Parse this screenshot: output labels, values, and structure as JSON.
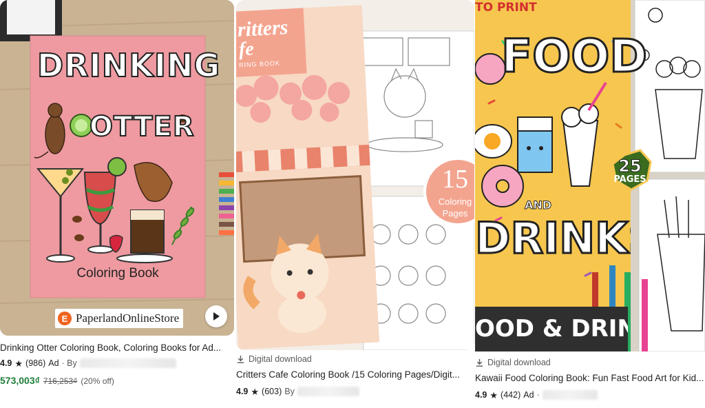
{
  "cards": [
    {
      "cover_title_line1": "DRINKING",
      "cover_title_line2": "OTTER",
      "cover_subtitle": "Coloring Book",
      "shop_logo_letter": "E",
      "shop_name": "PaperlandOnlineStore",
      "title": "Drinking Otter Coloring Book, Coloring Books for Ad...",
      "rating": "4.9",
      "reviews": "(986)",
      "ad_label": "Ad",
      "by_label": "· By",
      "price": "573,003₫",
      "original_price": "716,253₫",
      "discount": "(20% off)",
      "cover_color": "#ee9aa0",
      "price_color": "#1e7d3a"
    },
    {
      "cover_title_line1": "ritters",
      "cover_title_line2": "fe",
      "cover_subtitle": "RING BOOK",
      "badge_number": "15",
      "badge_line1": "Coloring",
      "badge_line2": "Pages",
      "download_label": "Digital download",
      "title": "Critters Cafe Coloring Book /15 Coloring Pages/Digit...",
      "rating": "4.9",
      "reviews": "(603)",
      "by_label": "By",
      "accent_color": "#f3a48f"
    },
    {
      "banner_text": "TO PRINT",
      "cover_word1": "FOOD",
      "cover_and": "AND",
      "cover_word2": "DRINKS",
      "badge_number": "25",
      "badge_label": "PAGES",
      "bottom_banner": "OOD & DRINKS",
      "download_label": "Digital download",
      "title": "Kawaii Food Coloring Book: Fun Fast Food Art for Kid...",
      "rating": "4.9",
      "reviews": "(442)",
      "ad_label": "Ad",
      "by_label": "·",
      "cover_color": "#f6c64e"
    }
  ],
  "icons": {
    "star": "star-icon",
    "download": "download-icon",
    "play": "play-icon"
  }
}
